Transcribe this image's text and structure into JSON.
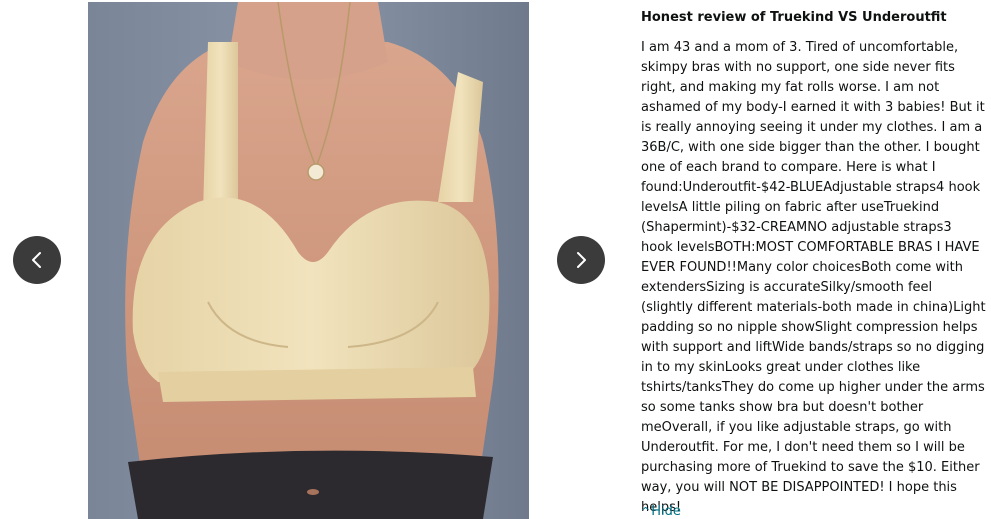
{
  "gallery": {
    "image_alt": "Customer review photo of a cream colored bra",
    "prev_icon": "chevron-left-icon",
    "next_icon": "chevron-right-icon"
  },
  "review": {
    "title": "Honest review of Truekind VS Underoutfit",
    "body": "I am 43 and a mom of 3. Tired of uncomfortable, skimpy bras with no support, one side never fits right, and making my fat rolls worse. I am not ashamed of my body-I earned it with 3 babies! But it is really annoying seeing it under my clothes. I am a 36B/C, with one side bigger than the other. I bought one of each brand to compare. Here is what I found:Underoutfit-$42-BLUEAdjustable straps4 hook levelsA little piling on fabric after useTruekind (Shapermint)-$32-CREAMNO adjustable straps3 hook levelsBOTH:MOST COMFORTABLE BRAS I HAVE EVER FOUND!!Many color choicesBoth come with extendersSizing is accurateSilky/smooth feel (slightly different materials-both made in china)Light padding so no nipple showSlight compression helps with support and liftWide bands/straps so no digging in to my skinLooks great under clothes like tshirts/tanksThey do come up higher under the arms so some tanks show bra but doesn't bother meOverall, if you like adjustable straps, go with Underoutfit. For me, I don't need them so I will be purchasing more of Truekind to save the $10. Either way, you will NOT BE DISAPPOINTED! I hope this helps!",
    "hide_caret": "^",
    "hide_label": "Hide"
  },
  "colors": {
    "link": "#007185",
    "text": "#0f1111",
    "nav_button": "#3b3b3b"
  }
}
